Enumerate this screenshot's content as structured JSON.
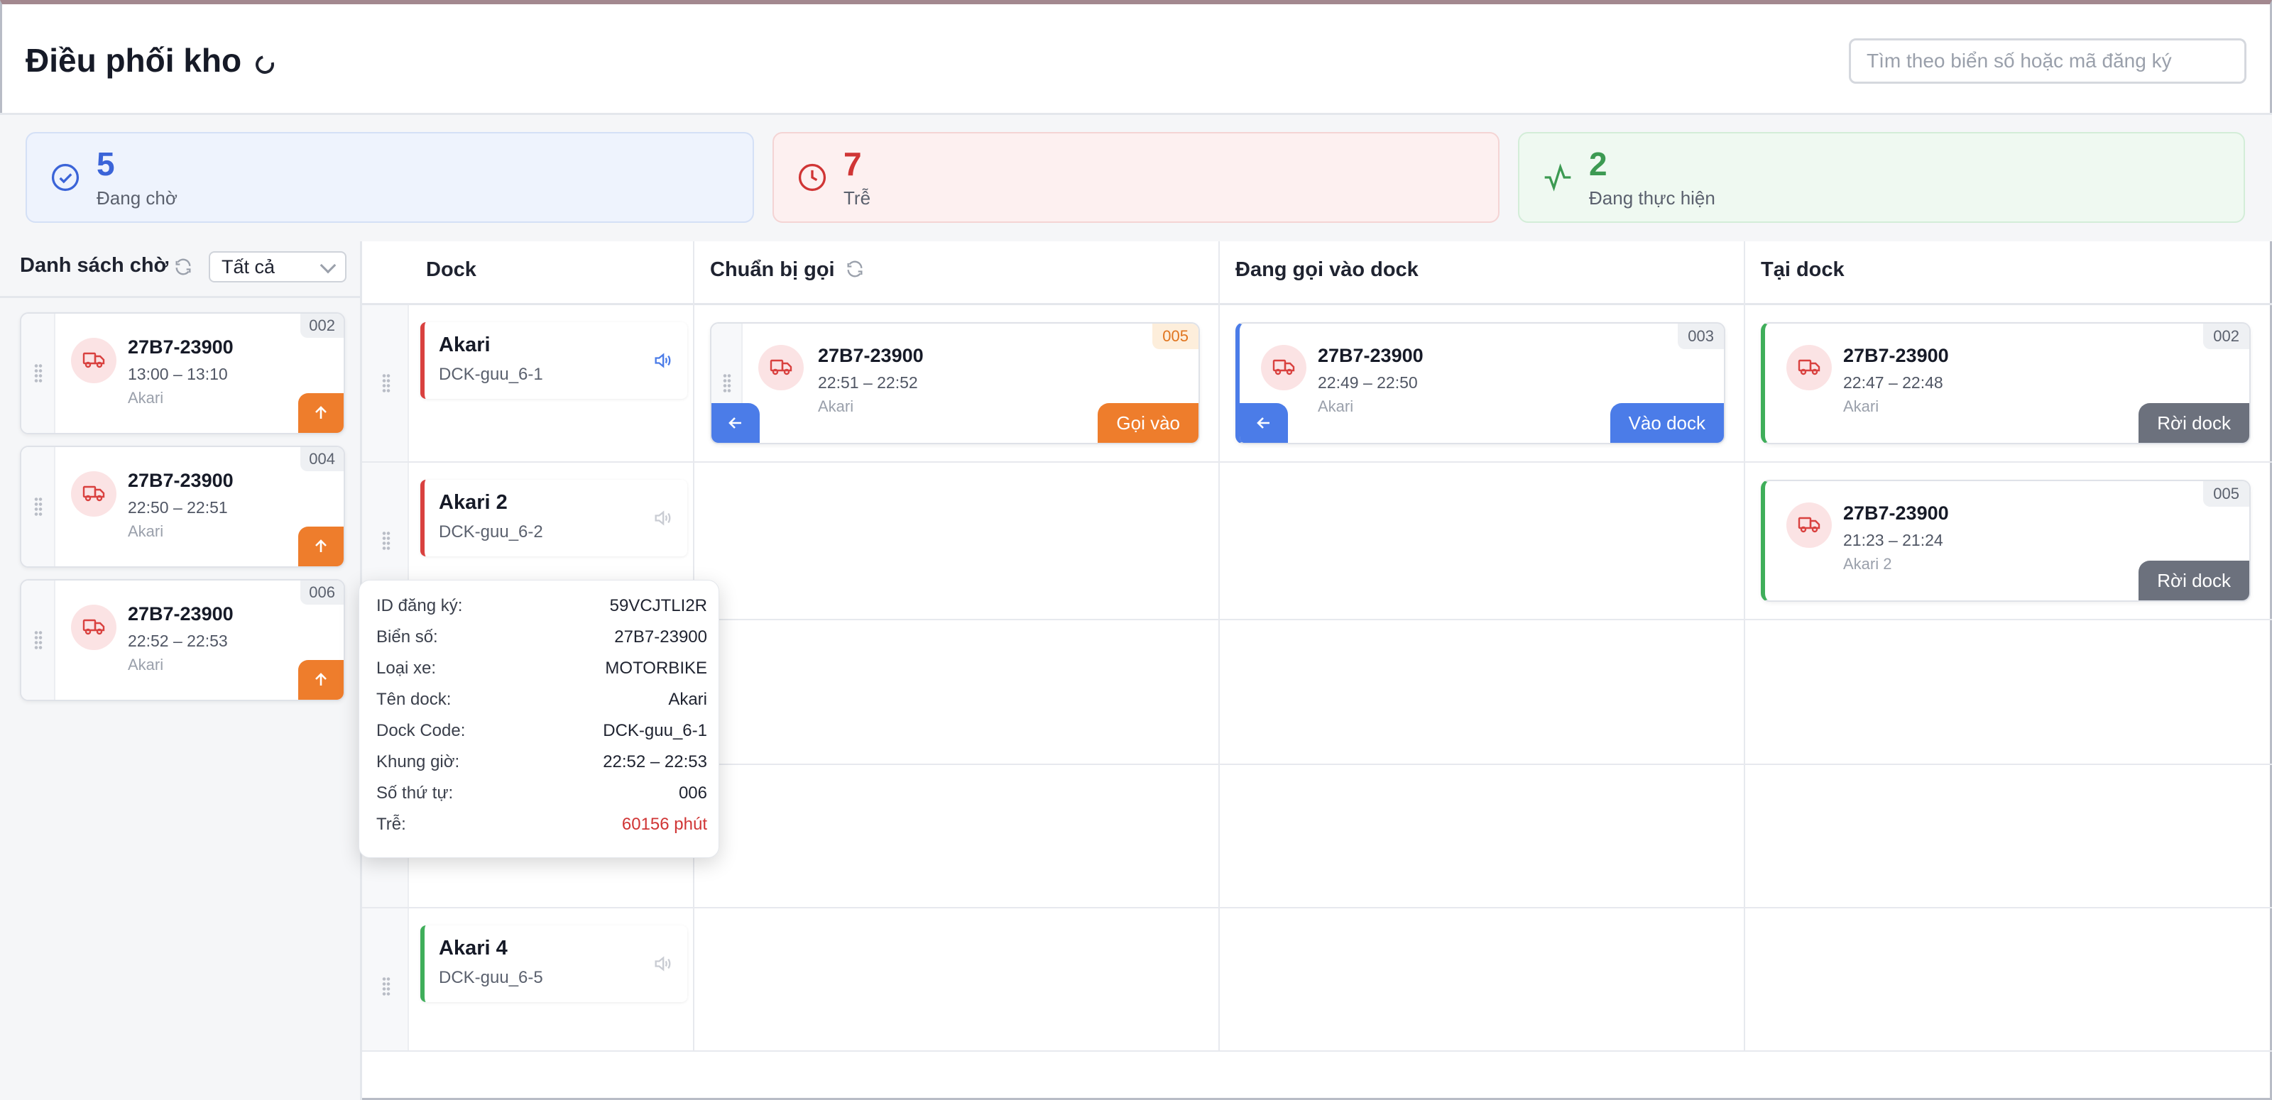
{
  "header": {
    "title": "Điều phối kho",
    "search_placeholder": "Tìm theo biển số hoặc mã đăng ký"
  },
  "stats": [
    {
      "value": "5",
      "label": "Đang chờ",
      "color": "#3b64d8",
      "icon": "check-circle-icon"
    },
    {
      "value": "7",
      "label": "Trễ",
      "color": "#d03535",
      "icon": "clock-icon"
    },
    {
      "value": "2",
      "label": "Đang thực hiện",
      "color": "#3c9a52",
      "icon": "activity-icon"
    }
  ],
  "queue": {
    "title": "Danh sách chờ",
    "filter": "Tất cả",
    "items": [
      {
        "plate": "27B7-23900",
        "time": "13:00 – 13:10",
        "warehouse": "Akari",
        "seq": "002"
      },
      {
        "plate": "27B7-23900",
        "time": "22:50 – 22:51",
        "warehouse": "Akari",
        "seq": "004"
      },
      {
        "plate": "27B7-23900",
        "time": "22:52 – 22:53",
        "warehouse": "Akari",
        "seq": "006"
      }
    ]
  },
  "board": {
    "columns": {
      "dock": "Dock",
      "prepare": "Chuẩn bị gọi",
      "calling": "Đang gọi vào dock",
      "at_dock": "Tại dock"
    },
    "docks": [
      {
        "name": "Akari",
        "code": "DCK-guu_6-1",
        "accent": "#d9413f"
      },
      {
        "name": "Akari 2",
        "code": "DCK-guu_6-2",
        "accent": "#d9413f"
      },
      {
        "name": "Akari 4",
        "code": "DCK-guu_6-5",
        "accent": "#3fae5a"
      }
    ],
    "prepare_card": {
      "plate": "27B7-23900",
      "time": "22:51 – 22:52",
      "warehouse": "Akari",
      "seq": "005",
      "action": "Gọi vào"
    },
    "calling_card": {
      "plate": "27B7-23900",
      "time": "22:49 – 22:50",
      "warehouse": "Akari",
      "seq": "003",
      "action": "Vào dock"
    },
    "at_dock_cards": [
      {
        "plate": "27B7-23900",
        "time": "22:47 – 22:48",
        "warehouse": "Akari",
        "seq": "002",
        "action": "Rời dock"
      },
      {
        "plate": "27B7-23900",
        "time": "21:23 – 21:24",
        "warehouse": "Akari 2",
        "seq": "005",
        "action": "Rời dock"
      }
    ]
  },
  "tooltip": {
    "rows": [
      {
        "key": "ID đăng ký:",
        "value": "59VCJTLI2R"
      },
      {
        "key": "Biển số:",
        "value": "27B7-23900"
      },
      {
        "key": "Loại xe:",
        "value": "MOTORBIKE"
      },
      {
        "key": "Tên dock:",
        "value": "Akari"
      },
      {
        "key": "Dock Code:",
        "value": "DCK-guu_6-1"
      },
      {
        "key": "Khung giờ:",
        "value": "22:52 – 22:53"
      },
      {
        "key": "Số thứ tự:",
        "value": "006"
      },
      {
        "key": "Trễ:",
        "value": "60156 phút"
      }
    ]
  },
  "colors": {
    "orange_action": "#ee7d2c",
    "blue_action": "#4b7ce8",
    "gray_action": "#6c717d",
    "calling_accent": "#4b7ce8",
    "at_dock_accent": "#3fae5a"
  }
}
